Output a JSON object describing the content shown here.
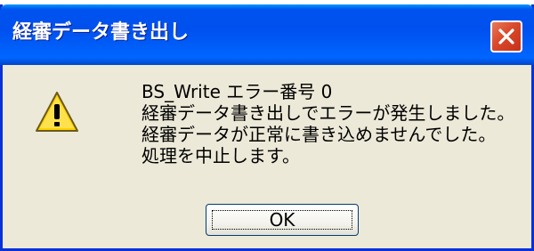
{
  "dialog": {
    "title": "経審データ書き出し",
    "close_icon": "close-icon",
    "icon": "warning-icon",
    "message_lines": [
      "BS_Write エラー番号  0",
      "経審データ書き出しでエラーが発生しました。",
      "経審データが正常に書き込めませんでした。",
      "処理を中止します。"
    ],
    "ok_label": "OK"
  },
  "colors": {
    "titlebar": "#0054e3",
    "close_button": "#d9492a",
    "dialog_background": "#ece9d8",
    "warning_fill": "#ffd200"
  }
}
